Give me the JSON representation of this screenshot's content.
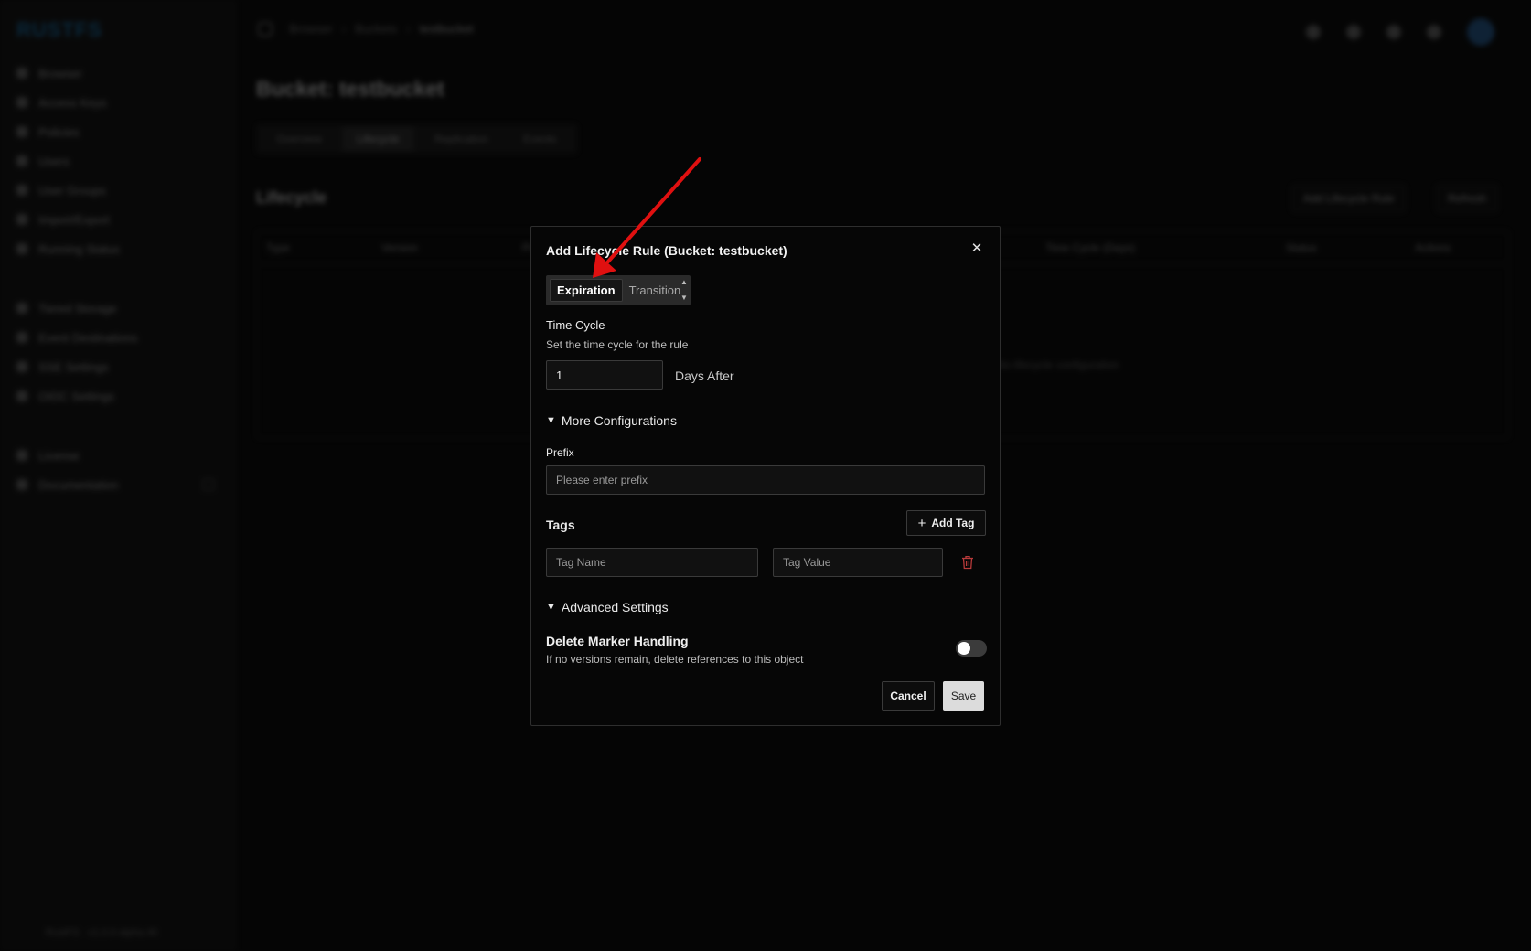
{
  "app": {
    "logo": "RUSTFS",
    "sidebar": {
      "items": [
        "Browser",
        "Access Keys",
        "Policies",
        "Users",
        "User Groups",
        "Import/Export",
        "Running Status",
        "Tiered Storage",
        "Event Destinations",
        "SSE Settings",
        "OIDC Settings",
        "License",
        "Documentation"
      ],
      "footer": "RustFS · v1.0.0-alpha.46"
    },
    "breadcrumb": [
      "Browser",
      "Buckets",
      "testbucket"
    ],
    "page_title": "Bucket: testbucket",
    "tabs": [
      "Overview",
      "Lifecycle",
      "Replication",
      "Events"
    ],
    "active_tab": "Lifecycle",
    "section_title": "Lifecycle",
    "add_rule_label": "Add Lifecycle Rule",
    "refresh_label": "Refresh",
    "table_headers": [
      "Type",
      "Version",
      "Prefix",
      "Time Cycle (Days)",
      "Status",
      "Actions"
    ],
    "empty_text": "No lifecycle configuration"
  },
  "modal": {
    "title": "Add Lifecycle Rule (Bucket: testbucket)",
    "close_glyph": "✕",
    "segments": [
      "Expiration",
      "Transition"
    ],
    "active_segment": "Expiration",
    "time_cycle": {
      "label": "Time Cycle",
      "help": "Set the time cycle for the rule",
      "value": "1",
      "suffix": "Days After"
    },
    "more_config_label": "More Configurations",
    "prefix": {
      "label": "Prefix",
      "placeholder": "Please enter prefix"
    },
    "tags": {
      "title": "Tags",
      "add_label": "Add Tag",
      "name_placeholder": "Tag Name",
      "value_placeholder": "Tag Value"
    },
    "advanced_label": "Advanced Settings",
    "delete_marker": {
      "title": "Delete Marker Handling",
      "help": "If no versions remain, delete references to this object",
      "enabled": false
    },
    "cancel_label": "Cancel",
    "save_label": "Save"
  },
  "colors": {
    "annotation_arrow": "#e01010",
    "trash_icon": "#b83a3a",
    "logo": "#1e7fc0"
  }
}
